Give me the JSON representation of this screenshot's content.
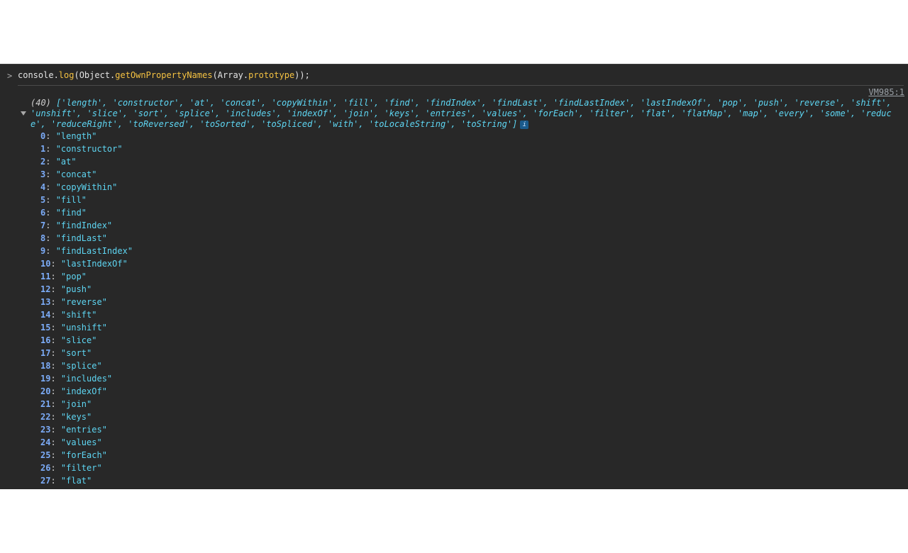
{
  "console": {
    "prompt_symbol": ">",
    "command": {
      "part1": "console.",
      "part2": "log",
      "part3": "(Object.",
      "part4": "getOwnPropertyNames",
      "part5": "(Array.",
      "part6": "prototype",
      "part7": "));"
    },
    "source_link": "VM985:1",
    "array_count": "(40)",
    "summary_items": [
      "length",
      "constructor",
      "at",
      "concat",
      "copyWithin",
      "fill",
      "find",
      "findIndex",
      "findLast",
      "findLastIndex",
      "lastIndexOf",
      "pop",
      "push",
      "reverse",
      "shift",
      "unshift",
      "slice",
      "sort",
      "splice",
      "includes",
      "indexOf",
      "join",
      "keys",
      "entries",
      "values",
      "forEach",
      "filter",
      "flat",
      "flatMap",
      "map",
      "every",
      "some",
      "reduce",
      "reduceRight",
      "toReversed",
      "toSorted",
      "toSpliced",
      "with",
      "toLocaleString",
      "toString"
    ],
    "info_icon": "i",
    "expanded_items": [
      {
        "index": "0",
        "value": "\"length\""
      },
      {
        "index": "1",
        "value": "\"constructor\""
      },
      {
        "index": "2",
        "value": "\"at\""
      },
      {
        "index": "3",
        "value": "\"concat\""
      },
      {
        "index": "4",
        "value": "\"copyWithin\""
      },
      {
        "index": "5",
        "value": "\"fill\""
      },
      {
        "index": "6",
        "value": "\"find\""
      },
      {
        "index": "7",
        "value": "\"findIndex\""
      },
      {
        "index": "8",
        "value": "\"findLast\""
      },
      {
        "index": "9",
        "value": "\"findLastIndex\""
      },
      {
        "index": "10",
        "value": "\"lastIndexOf\""
      },
      {
        "index": "11",
        "value": "\"pop\""
      },
      {
        "index": "12",
        "value": "\"push\""
      },
      {
        "index": "13",
        "value": "\"reverse\""
      },
      {
        "index": "14",
        "value": "\"shift\""
      },
      {
        "index": "15",
        "value": "\"unshift\""
      },
      {
        "index": "16",
        "value": "\"slice\""
      },
      {
        "index": "17",
        "value": "\"sort\""
      },
      {
        "index": "18",
        "value": "\"splice\""
      },
      {
        "index": "19",
        "value": "\"includes\""
      },
      {
        "index": "20",
        "value": "\"indexOf\""
      },
      {
        "index": "21",
        "value": "\"join\""
      },
      {
        "index": "22",
        "value": "\"keys\""
      },
      {
        "index": "23",
        "value": "\"entries\""
      },
      {
        "index": "24",
        "value": "\"values\""
      },
      {
        "index": "25",
        "value": "\"forEach\""
      },
      {
        "index": "26",
        "value": "\"filter\""
      },
      {
        "index": "27",
        "value": "\"flat\""
      }
    ]
  }
}
